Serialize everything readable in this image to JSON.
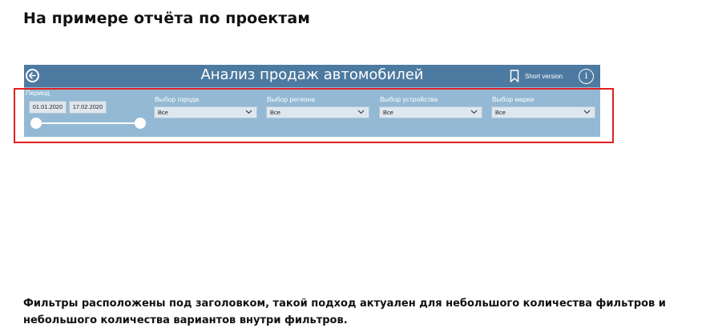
{
  "page": {
    "title": "На примере отчёта по проектам",
    "caption": "Фильтры расположены под заголовком, такой подход актуален для небольшого количества фильтров и небольшого количества вариантов внутри фильтров."
  },
  "report": {
    "title": "Анализ продаж автомобилей",
    "short_version": "Short version",
    "info_glyph": "i",
    "colors": {
      "header_bg": "#4d7aa0",
      "panel_bg": "#93b9d4",
      "highlight": "#e02020"
    },
    "period": {
      "label": "Период",
      "start": "01.01.2020",
      "end": "17.02.2020"
    },
    "filters": [
      {
        "label": "Выбор города",
        "value": "Все"
      },
      {
        "label": "Выбор региона",
        "value": "Все"
      },
      {
        "label": "Выбор устройства",
        "value": "Все"
      },
      {
        "label": "Выбор марки",
        "value": "Все"
      }
    ]
  }
}
